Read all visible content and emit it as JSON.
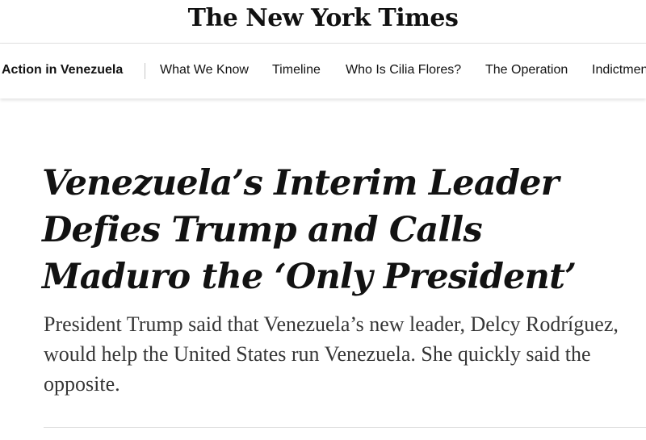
{
  "masthead": {
    "logo_text": "The New York Times"
  },
  "nav": {
    "section_label": "Action in Venezuela",
    "links": [
      "What We Know",
      "Timeline",
      "Who Is Cilia Flores?",
      "The Operation",
      "Indictment"
    ]
  },
  "article": {
    "headline": "Venezuela’s Interim Leader Defies Trump and Calls Maduro the ‘Only President’",
    "summary": "President Trump said that Venezuela’s new leader, Delcy Rodríguez, would help the United States run Venezuela. She quickly said the opposite."
  }
}
